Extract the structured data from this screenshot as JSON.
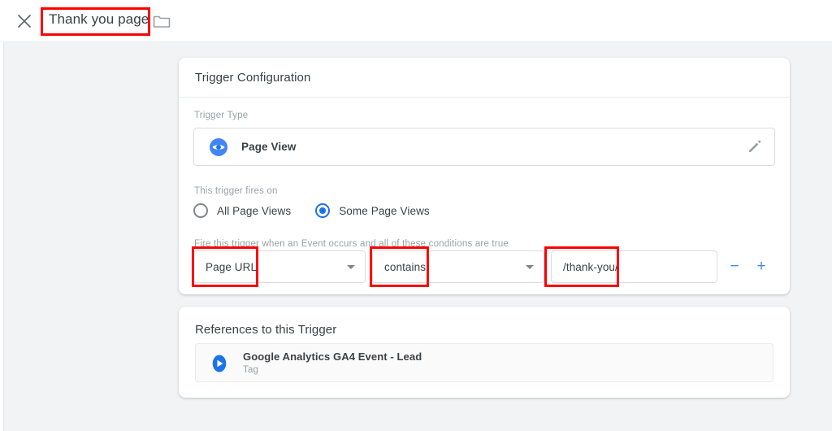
{
  "header": {
    "close_icon": "close-icon",
    "trigger_name": "Thank you page",
    "folder_icon": "folder-icon"
  },
  "trigger_configuration": {
    "card_title": "Trigger Configuration",
    "trigger_type_label": "Trigger Type",
    "trigger_type": {
      "icon": "page-view-eye-icon",
      "name": "Page View",
      "edit_icon": "pencil-edit-icon"
    },
    "fires_on_label": "This trigger fires on",
    "radio_options": [
      {
        "label": "All Page Views",
        "selected": false
      },
      {
        "label": "Some Page Views",
        "selected": true
      }
    ],
    "conditions_label": "Fire this trigger when an Event occurs and all of these conditions are true",
    "condition": {
      "variable": "Page URL",
      "operator": "contains",
      "value": "/thank-you/",
      "value_placeholder": "",
      "remove_label": "−",
      "add_label": "+"
    }
  },
  "references": {
    "card_title": "References to this Trigger",
    "items": [
      {
        "icon": "ga4-tag-icon",
        "name": "Google Analytics GA4 Event - Lead",
        "type": "Tag"
      }
    ]
  },
  "colors": {
    "accent_blue": "#1a73e8",
    "icon_blue": "#4285f4",
    "annotation_red": "#ff0000",
    "page_background": "#f1f3f4",
    "text_primary": "#3c4043",
    "text_secondary": "#9aa0a6"
  }
}
